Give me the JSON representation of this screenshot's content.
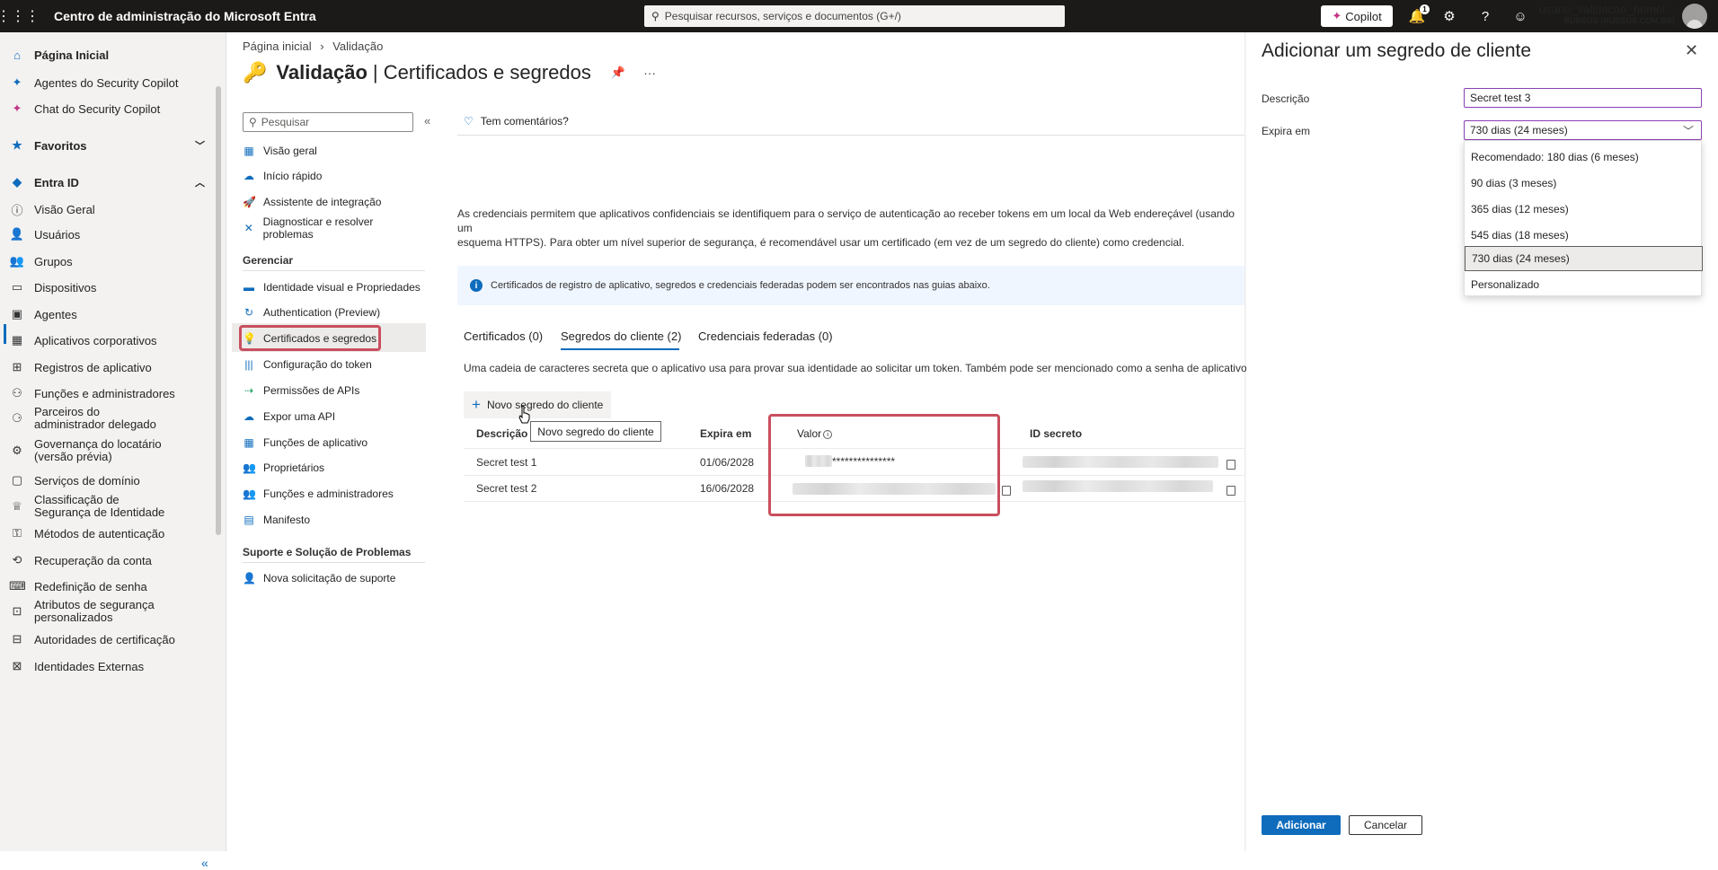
{
  "topbar": {
    "title": "Centro de administração do Microsoft Entra",
    "search_placeholder": "Pesquisar recursos, serviços e documentos (G+/)",
    "copilot_label": "Copilot",
    "notification_count": "1",
    "user_name": "usario_validacao_homol...",
    "tenant": "RUBEUS (RUBEUS.COM.BR)"
  },
  "leftnav": {
    "items": [
      {
        "label": "Página Inicial",
        "icon": "home-icon"
      },
      {
        "label": "Agentes do Security Copilot",
        "icon": "copilot-icon"
      },
      {
        "label": "Chat do Security Copilot",
        "icon": "copilot-icon"
      },
      {
        "label": "Favoritos",
        "icon": "star-icon"
      },
      {
        "label": "Entra ID",
        "icon": "entra-icon"
      },
      {
        "label": "Visão Geral",
        "icon": "info-icon"
      },
      {
        "label": "Usuários",
        "icon": "user-icon"
      },
      {
        "label": "Grupos",
        "icon": "group-icon"
      },
      {
        "label": "Dispositivos",
        "icon": "device-icon"
      },
      {
        "label": "Agentes",
        "icon": "agent-icon"
      },
      {
        "label": "Aplicativos corporativos",
        "icon": "apps-icon"
      },
      {
        "label": "Registros de aplicativo",
        "icon": "app-registration-icon"
      },
      {
        "label": "Funções e administradores",
        "icon": "roles-icon"
      },
      {
        "label": "Parceiros do administrador delegado",
        "icon": "partners-icon"
      },
      {
        "label": "Governança do locatário (versão prévia)",
        "icon": "governance-icon"
      },
      {
        "label": "Serviços de domínio",
        "icon": "domain-icon"
      },
      {
        "label": "Classificação de Segurança de Identidade",
        "icon": "trophy-icon"
      },
      {
        "label": "Métodos de autenticação",
        "icon": "auth-methods-icon"
      },
      {
        "label": "Recuperação da conta",
        "icon": "recovery-icon"
      },
      {
        "label": "Redefinição de senha",
        "icon": "password-icon"
      },
      {
        "label": "Atributos de segurança personalizados",
        "icon": "attributes-icon"
      },
      {
        "label": "Autoridades de certificação",
        "icon": "certificate-icon"
      },
      {
        "label": "Identidades Externas",
        "icon": "external-identities-icon"
      }
    ]
  },
  "breadcrumb": {
    "home": "Página inicial",
    "sep": "›",
    "current": "Validação"
  },
  "page": {
    "title_bold": "Validação",
    "title_rest": "| Certificados e segredos"
  },
  "resource_menu": {
    "search_placeholder": "Pesquisar",
    "items_top": [
      {
        "label": "Visão geral",
        "icon": "overview-icon"
      },
      {
        "label": "Início rápido",
        "icon": "quickstart-icon"
      },
      {
        "label": "Assistente de integração",
        "icon": "rocket-icon"
      },
      {
        "label": "Diagnosticar e resolver problemas",
        "icon": "wrench-icon"
      }
    ],
    "manage_header": "Gerenciar",
    "items_manage": [
      {
        "label": "Identidade visual e Propriedades",
        "icon": "branding-icon"
      },
      {
        "label": "Authentication (Preview)",
        "icon": "auth-icon"
      },
      {
        "label": "Certificados e segredos",
        "icon": "key-icon"
      },
      {
        "label": "Configuração do token",
        "icon": "token-icon"
      },
      {
        "label": "Permissões de APIs",
        "icon": "api-permissions-icon"
      },
      {
        "label": "Expor uma API",
        "icon": "cloud-icon"
      },
      {
        "label": "Funções de aplicativo",
        "icon": "app-roles-icon"
      },
      {
        "label": "Proprietários",
        "icon": "owners-icon"
      },
      {
        "label": "Funções e administradores",
        "icon": "roles-admin-icon"
      },
      {
        "label": "Manifesto",
        "icon": "manifest-icon"
      }
    ],
    "support_header": "Suporte e Solução de Problemas",
    "items_support": [
      {
        "label": "Nova solicitação de suporte",
        "icon": "support-icon"
      }
    ]
  },
  "main": {
    "feedback": "Tem comentários?",
    "description_line1": "As credenciais permitem que aplicativos confidenciais se identifiquem para o serviço de autenticação ao receber tokens em um local da Web endereçável (usando um",
    "description_line2": "esquema HTTPS). Para obter um nível superior de segurança, é recomendável usar um certificado (em vez de um segredo do cliente) como credencial.",
    "info_banner": "Certificados de registro de aplicativo, segredos e credenciais federadas podem ser encontrados nas guias abaixo.",
    "tabs": [
      "Certificados (0)",
      "Segredos do cliente (2)",
      "Credenciais federadas (0)"
    ],
    "subdescription": "Uma cadeia de caracteres secreta que o aplicativo usa para provar sua identidade ao solicitar um token. Também pode ser mencionado como a senha de aplicativo.",
    "new_secret_button": "Novo segredo do cliente",
    "tooltip": "Novo segredo do cliente",
    "columns": [
      "Descrição",
      "Expira em",
      "Valor",
      "ID secreto"
    ],
    "rows": [
      {
        "description": "Secret test 1",
        "expires": "01/06/2028",
        "value": "***************"
      },
      {
        "description": "Secret test 2",
        "expires": "16/06/2028",
        "value": ""
      }
    ]
  },
  "panel": {
    "title": "Adicionar um segredo de cliente",
    "description_label": "Descrição",
    "description_value": "Secret test 3",
    "expires_label": "Expira em",
    "expires_value": "730 dias (24 meses)",
    "options": [
      "Recomendado: 180 dias (6 meses)",
      "90 dias (3 meses)",
      "365 dias (12 meses)",
      "545 dias (18 meses)",
      "730 dias (24 meses)",
      "Personalizado"
    ],
    "add_button": "Adicionar",
    "cancel_button": "Cancelar"
  },
  "colors": {
    "accent": "#0f6cbd",
    "highlight": "#c94f5e",
    "topbar": "#1b1a19",
    "input_border": "#8a3fb3"
  }
}
